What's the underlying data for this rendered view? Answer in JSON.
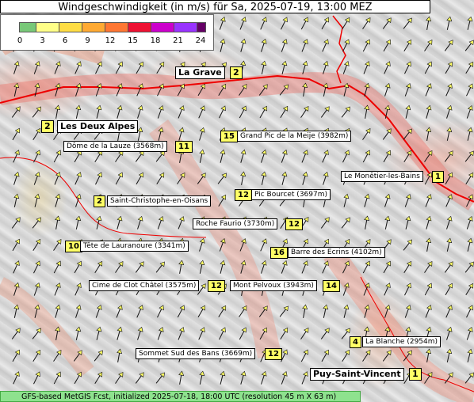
{
  "title": "Windgeschwindigkeit (in m/s) für Sa, 2025-07-19, 13:00 MEZ",
  "legend": {
    "ticks": [
      "0",
      "3",
      "6",
      "9",
      "12",
      "15",
      "18",
      "21",
      "24"
    ],
    "colors": [
      "#78c878",
      "#ffff88",
      "#ffdd44",
      "#ffaa33",
      "#ff7733",
      "#ee1133",
      "#cc00cc",
      "#9933ff",
      "#660066"
    ]
  },
  "footer": "GFS-based MetGIS Fcst, initialized 2025-07-18, 18:00 UTC  (resolution 45 m X 63 m)",
  "places": [
    {
      "name": "La Grave",
      "speed": "2",
      "big": true
    },
    {
      "name": "Les Deux Alpes",
      "speed": "2",
      "big": true
    },
    {
      "name": "Dôme de la Lauze (3568m)",
      "speed": "11"
    },
    {
      "name": "Grand Pic de la Meije (3982m)",
      "speed": "15"
    },
    {
      "name": "Le Monêtier-les-Bains",
      "speed": "1"
    },
    {
      "name": "Pic Bourcet (3697m)",
      "speed": "12"
    },
    {
      "name": "Saint-Christophe-en-Oisans",
      "speed": "2"
    },
    {
      "name": "Roche Faurio (3730m)",
      "speed": "12"
    },
    {
      "name": "Tête de Lauranoure (3341m)",
      "speed": "10"
    },
    {
      "name": "Barre des Ecrins (4102m)",
      "speed": "16"
    },
    {
      "name": "Cime de Clot Châtel (3575m)",
      "speed": "12"
    },
    {
      "name": "Mont Pelvoux (3943m)",
      "speed": "14"
    },
    {
      "name": "La Blanche (2954m)",
      "speed": "4"
    },
    {
      "name": "Sommet Sud des Bans (3669m)",
      "speed": "12"
    },
    {
      "name": "Puy-Saint-Vincent",
      "speed": "1",
      "big": true
    }
  ]
}
